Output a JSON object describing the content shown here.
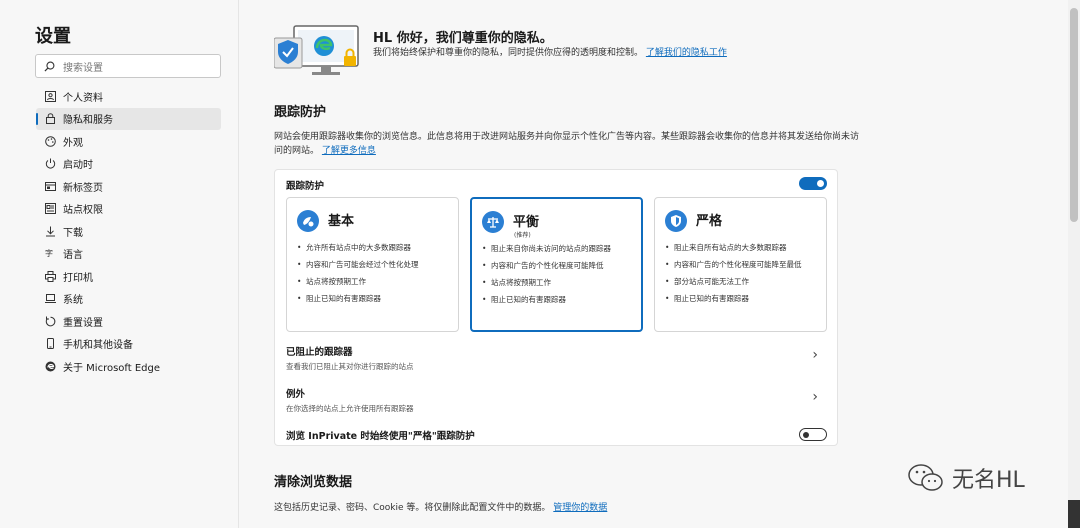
{
  "sidebar": {
    "title": "设置",
    "search_placeholder": "搜索设置",
    "items": [
      {
        "label": "个人资料",
        "icon": "profile-icon"
      },
      {
        "label": "隐私和服务",
        "icon": "lock-icon",
        "active": true
      },
      {
        "label": "外观",
        "icon": "palette-icon"
      },
      {
        "label": "启动时",
        "icon": "power-icon"
      },
      {
        "label": "新标签页",
        "icon": "new-tab-icon"
      },
      {
        "label": "站点权限",
        "icon": "site-permissions-icon"
      },
      {
        "label": "下载",
        "icon": "download-icon"
      },
      {
        "label": "语言",
        "icon": "language-icon"
      },
      {
        "label": "打印机",
        "icon": "printer-icon"
      },
      {
        "label": "系统",
        "icon": "system-icon"
      },
      {
        "label": "重置设置",
        "icon": "reset-icon"
      },
      {
        "label": "手机和其他设备",
        "icon": "phone-icon"
      },
      {
        "label": "关于 Microsoft Edge",
        "icon": "edge-icon"
      }
    ]
  },
  "hero": {
    "title": "HL 你好，我们尊重你的隐私。",
    "desc": "我们将始终保护和尊重你的隐私，同时提供你应得的透明度和控制。",
    "link": "了解我们的隐私工作"
  },
  "tracking": {
    "title": "跟踪防护",
    "desc": "网站会使用跟踪器收集你的浏览信息。此信息将用于改进网站服务并向你显示个性化广告等内容。某些跟踪器会收集你的信息并将其发送给你尚未访问的网站。",
    "desc_link": "了解更多信息",
    "card_title": "跟踪防护",
    "toggle_on": true,
    "options": [
      {
        "name": "基本",
        "sub": "",
        "icon": "basic-icon",
        "selected": false,
        "bullets": [
          "允许所有站点中的大多数跟踪器",
          "内容和广告可能会经过个性化处理",
          "站点将按预期工作",
          "阻止已知的有害跟踪器"
        ]
      },
      {
        "name": "平衡",
        "sub": "(推荐)",
        "icon": "balance-scale-icon",
        "selected": true,
        "bullets": [
          "阻止来自你尚未访问的站点的跟踪器",
          "内容和广告的个性化程度可能降低",
          "站点将按预期工作",
          "阻止已知的有害跟踪器"
        ]
      },
      {
        "name": "严格",
        "sub": "",
        "icon": "shield-icon",
        "selected": false,
        "bullets": [
          "阻止来自所有站点的大多数跟踪器",
          "内容和广告的个性化程度可能降至最低",
          "部分站点可能无法工作",
          "阻止已知的有害跟踪器"
        ]
      }
    ],
    "blocked": {
      "title": "已阻止的跟踪器",
      "sub": "查看我们已阻止其对你进行跟踪的站点"
    },
    "exceptions": {
      "title": "例外",
      "sub": "在你选择的站点上允许使用所有跟踪器"
    },
    "inprivate": {
      "title": "浏览 InPrivate 时始终使用\"严格\"跟踪防护",
      "on": false
    }
  },
  "clear": {
    "title": "清除浏览数据",
    "desc": "这包括历史记录、密码、Cookie 等。将仅删除此配置文件中的数据。",
    "link": "管理你的数据"
  },
  "watermark": "无名HL",
  "colors": {
    "accent": "#0f6cbd",
    "shield": "#2b7fd3"
  }
}
